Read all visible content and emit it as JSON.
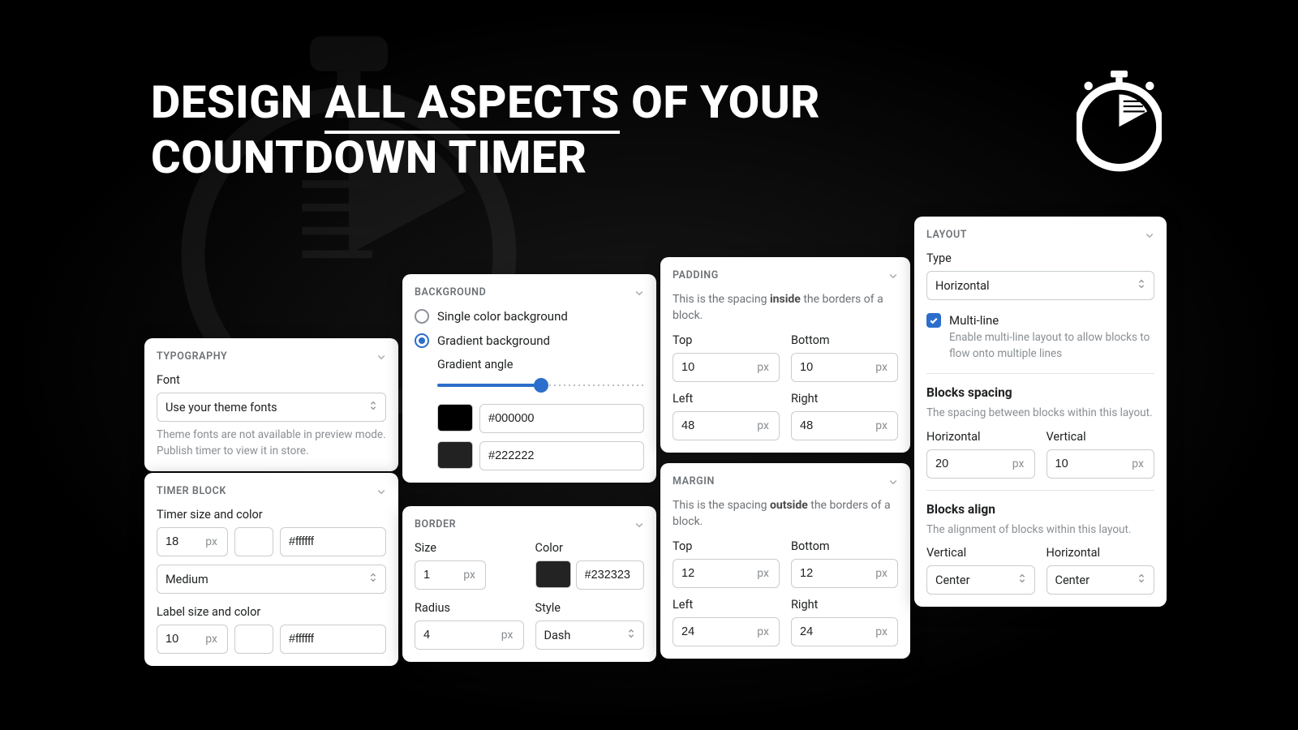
{
  "hero": {
    "line1_pre": "DESIGN ",
    "line1_underlined": "ALL ASPECTS",
    "line1_post": " OF YOUR",
    "line2": "COUNTDOWN TIMER"
  },
  "typography": {
    "header": "TYPOGRAPHY",
    "font_label": "Font",
    "font_value": "Use your theme fonts",
    "font_help": "Theme fonts are not available in preview mode. Publish timer to view it in store."
  },
  "timer_block": {
    "header": "TIMER BLOCK",
    "timer_label": "Timer size and color",
    "timer_size": "18",
    "timer_unit": "px",
    "timer_color": "#ffffff",
    "weight_value": "Medium",
    "label_label": "Label size and color",
    "label_size": "10",
    "label_unit": "px",
    "label_color": "#ffffff"
  },
  "background": {
    "header": "BACKGROUND",
    "option_single": "Single color background",
    "option_gradient": "Gradient background",
    "angle_label": "Gradient angle",
    "color1": "#000000",
    "color1_swatch": "#000000",
    "color2": "#222222",
    "color2_swatch": "#222222"
  },
  "border": {
    "header": "BORDER",
    "size_label": "Size",
    "size_value": "1",
    "size_unit": "px",
    "color_label": "Color",
    "color_value": "#232323",
    "color_swatch": "#232323",
    "radius_label": "Radius",
    "radius_value": "4",
    "radius_unit": "px",
    "style_label": "Style",
    "style_value": "Dash"
  },
  "padding": {
    "header": "PADDING",
    "desc_pre": "This is the spacing ",
    "desc_bold": "inside",
    "desc_post": " the borders of a block.",
    "top_label": "Top",
    "top_value": "10",
    "bottom_label": "Bottom",
    "bottom_value": "10",
    "left_label": "Left",
    "left_value": "48",
    "right_label": "Right",
    "right_value": "48",
    "unit": "px"
  },
  "margin": {
    "header": "MARGIN",
    "desc_pre": "This is the spacing ",
    "desc_bold": "outside",
    "desc_post": " the borders of a block.",
    "top_label": "Top",
    "top_value": "12",
    "bottom_label": "Bottom",
    "bottom_value": "12",
    "left_label": "Left",
    "left_value": "24",
    "right_label": "Right",
    "right_value": "24",
    "unit": "px"
  },
  "layout": {
    "header": "LAYOUT",
    "type_label": "Type",
    "type_value": "Horizontal",
    "multiline_label": "Multi-line",
    "multiline_help": "Enable multi-line layout to allow blocks to flow onto multiple lines",
    "spacing_title": "Blocks spacing",
    "spacing_help": "The spacing between blocks within this layout.",
    "h_label": "Horizontal",
    "h_value": "20",
    "v_label": "Vertical",
    "v_value": "10",
    "unit": "px",
    "align_title": "Blocks align",
    "align_help": "The alignment of blocks within this layout.",
    "align_v_label": "Vertical",
    "align_v_value": "Center",
    "align_h_label": "Horizontal",
    "align_h_value": "Center"
  }
}
